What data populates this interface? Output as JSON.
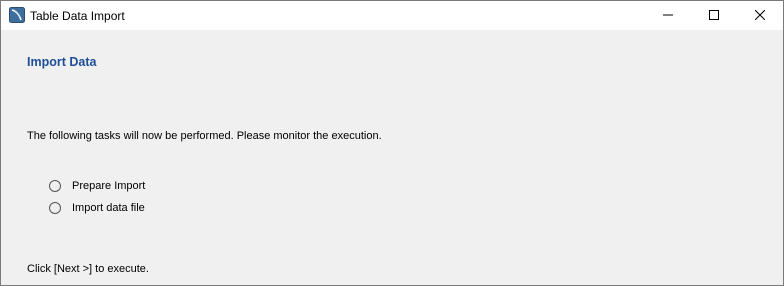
{
  "window": {
    "title": "Table Data Import",
    "app_icon": "mysql-workbench-icon",
    "controls": [
      "minimize-icon",
      "maximize-icon",
      "close-icon"
    ]
  },
  "page": {
    "heading": "Import Data",
    "intro": "The following tasks will now be performed. Please monitor the execution.",
    "tasks": [
      {
        "label": "Prepare Import"
      },
      {
        "label": "Import data file"
      }
    ],
    "footer": "Click [Next >] to execute."
  },
  "colors": {
    "heading": "#1f4e96",
    "background": "#f0f0f0",
    "titlebar": "#ffffff"
  }
}
